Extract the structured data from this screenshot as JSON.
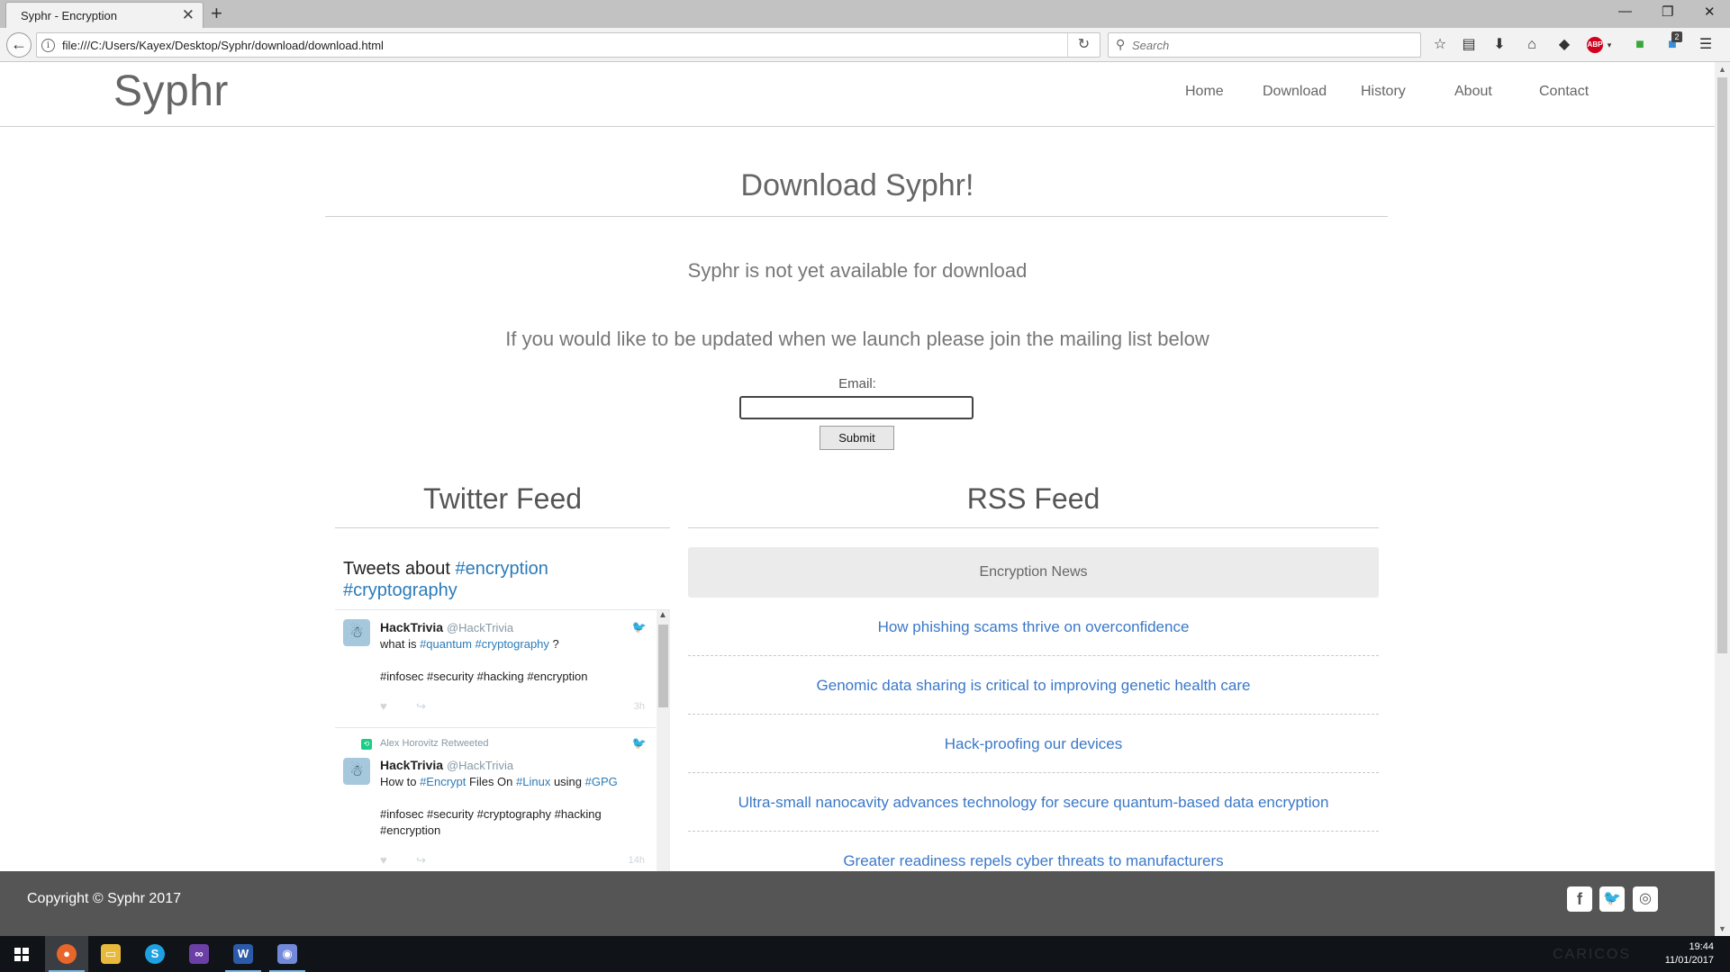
{
  "browser": {
    "tab_title": "Syphr - Encryption",
    "url": "file:///C:/Users/Kayex/Desktop/Syphr/download/download.html",
    "search_placeholder": "Search",
    "toolbar_badge": "2",
    "abp_label": "ABP"
  },
  "site": {
    "logo": "Syphr",
    "nav": [
      "Home",
      "Download",
      "History",
      "About",
      "Contact"
    ]
  },
  "main": {
    "title": "Download Syphr!",
    "notice": "Syphr is not yet available for download",
    "mailing_text": "If you would like to be updated when we launch please join the mailing list below",
    "email_label": "Email:",
    "email_value": "",
    "submit_label": "Submit"
  },
  "twitter": {
    "section_title": "Twitter Feed",
    "heading_prefix": "Tweets about ",
    "heading_tags": [
      "#encryption",
      "#cryptography"
    ],
    "tweets": [
      {
        "name": "HackTrivia",
        "handle": "@HackTrivia",
        "line1_prefix": "what is ",
        "line1_tags": [
          "#quantum",
          "#cryptography"
        ],
        "line1_suffix": " ?",
        "line2_tags": "#infosec #security #hacking #encryption",
        "time": "3h"
      },
      {
        "retweeted_by": "Alex Horovitz Retweeted",
        "name": "HackTrivia",
        "handle": "@HackTrivia",
        "line1_a": "How to ",
        "line1_tag1": "#Encrypt",
        "line1_b": " Files On ",
        "line1_tag2": "#Linux",
        "line1_c": " using ",
        "line1_tag3": "#GPG",
        "line2_tags": "#infosec #security #cryptography #hacking",
        "line3_tags": "#encryption",
        "time": "14h"
      }
    ]
  },
  "rss": {
    "section_title": "RSS Feed",
    "header": "Encryption News",
    "items": [
      "How phishing scams thrive on overconfidence",
      "Genomic data sharing is critical to improving genetic health care",
      "Hack-proofing our devices",
      "Ultra-small nanocavity advances technology for secure quantum-based data encryption",
      "Greater readiness repels cyber threats to manufacturers"
    ]
  },
  "footer": {
    "copyright": "Copyright © Syphr 2017",
    "social": [
      "facebook-icon",
      "twitter-icon",
      "instagram-icon"
    ]
  },
  "taskbar": {
    "time": "19:44",
    "date": "11/01/2017",
    "watermark": "CARICOS",
    "apps": [
      "firefox-icon",
      "file-explorer-icon",
      "skype-icon",
      "visual-studio-icon",
      "word-icon",
      "discord-icon"
    ]
  },
  "colors": {
    "link_blue": "#3a78c8",
    "twitter_blue": "#2b7bb9",
    "footer_bg": "#555555",
    "taskbar_bg": "#101418"
  }
}
